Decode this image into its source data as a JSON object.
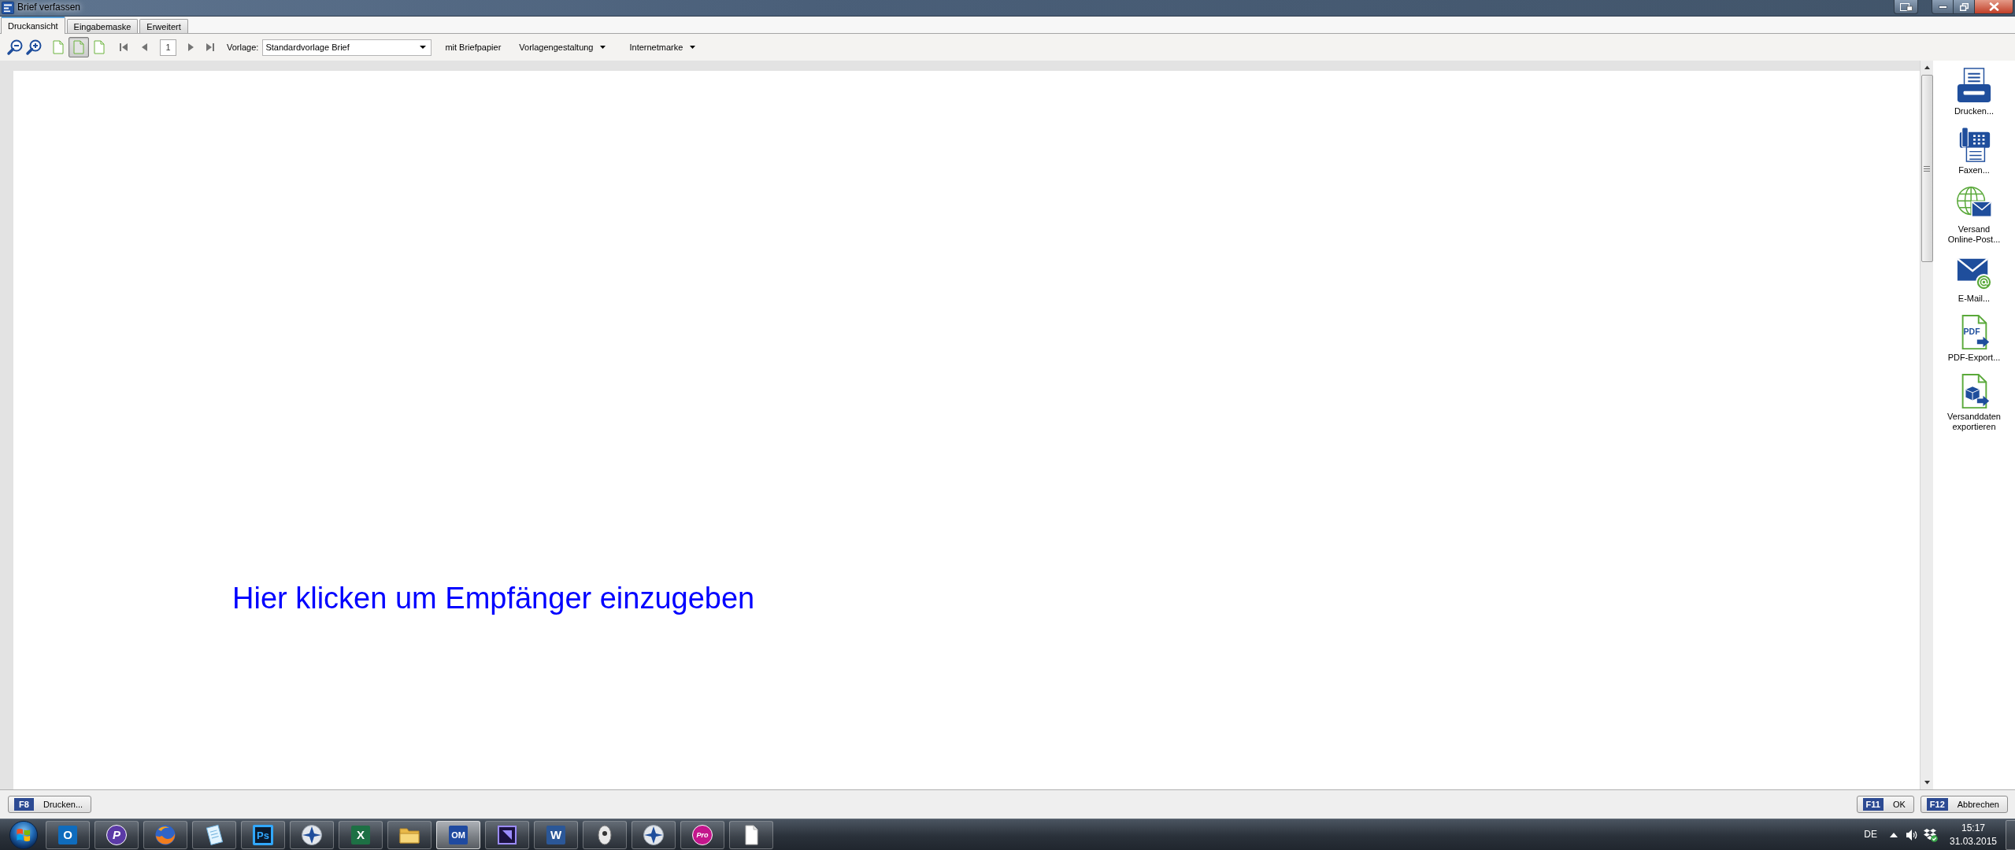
{
  "window": {
    "title": "Brief verfassen"
  },
  "tabs": [
    {
      "label": "Druckansicht",
      "selected": true
    },
    {
      "label": "Eingabemaske",
      "selected": false
    },
    {
      "label": "Erweitert",
      "selected": false
    }
  ],
  "toolbar": {
    "view_buttons": [
      {
        "selected": false
      },
      {
        "selected": true
      },
      {
        "selected": false
      }
    ],
    "page_number": "1",
    "template_label": "Vorlage:",
    "template_value": "Standardvorlage Brief",
    "letterhead_button": "mit Briefpapier",
    "menus": [
      {
        "label": "Vorlagengestaltung"
      },
      {
        "label": "Internetmarke"
      }
    ]
  },
  "document": {
    "recipient_prompt": "Hier klicken um Empfänger einzugeben"
  },
  "actions": [
    {
      "kind": "print",
      "label": "Drucken..."
    },
    {
      "kind": "fax",
      "label": "Faxen..."
    },
    {
      "kind": "online-post",
      "label": "Versand Online-Post..."
    },
    {
      "kind": "email",
      "label": "E-Mail..."
    },
    {
      "kind": "pdf",
      "label": "PDF-Export...",
      "icon_text": "PDF"
    },
    {
      "kind": "shipping-export",
      "label": "Versanddaten exportieren"
    }
  ],
  "footer": {
    "left_buttons": [
      {
        "key": "F8",
        "label": "Drucken..."
      }
    ],
    "right_buttons": [
      {
        "key": "F11",
        "label": "OK"
      },
      {
        "key": "F12",
        "label": "Abbrechen"
      }
    ]
  },
  "taskbar": {
    "apps": [
      {
        "kind": "letter-tile",
        "text": "O",
        "color": "#0f6cbd",
        "selected": false
      },
      {
        "kind": "letter-circle",
        "text": "P",
        "color": "#5b3aa6",
        "selected": false
      },
      {
        "kind": "fox-globe",
        "selected": false
      },
      {
        "kind": "notepad",
        "selected": false
      },
      {
        "kind": "outline-tile",
        "text": "Ps",
        "color": "#31a8ff",
        "selected": false
      },
      {
        "kind": "star-disc",
        "selected": false
      },
      {
        "kind": "letter-tile",
        "text": "X",
        "color": "#1d7044",
        "selected": false
      },
      {
        "kind": "folder",
        "selected": false
      },
      {
        "kind": "letter-tile",
        "text": "OM",
        "color": "#1f4aa0",
        "selected": true
      },
      {
        "kind": "gradient-tile",
        "color": "#9b8cff",
        "selected": false
      },
      {
        "kind": "letter-tile",
        "text": "W",
        "color": "#2b5797",
        "selected": false
      },
      {
        "kind": "mouse",
        "selected": false
      },
      {
        "kind": "star-disc",
        "selected": false
      },
      {
        "kind": "letter-circle",
        "text": "Pro",
        "color": "#c4168c",
        "selected": false
      },
      {
        "kind": "page",
        "selected": false
      }
    ],
    "tray": {
      "language": "DE",
      "time": "15:17",
      "date": "31.03.2015"
    }
  }
}
